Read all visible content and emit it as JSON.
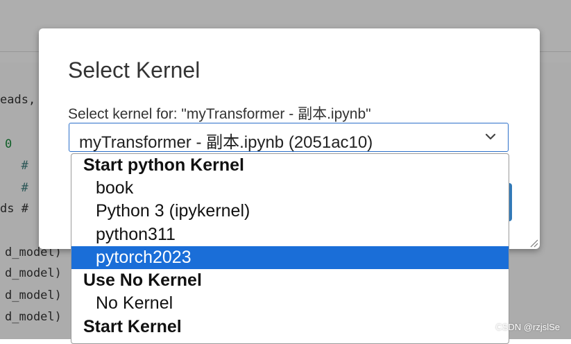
{
  "background": {
    "code_lines": [
      {
        "text": "eads,",
        "y": 0
      },
      {
        "text": "0",
        "y": 1
      },
      {
        "text": "  #",
        "y": 2
      },
      {
        "text": "  #",
        "y": 3
      },
      {
        "text": "ds #",
        "y": 4
      },
      {
        "text": "d_model)",
        "y": 5
      },
      {
        "text": "d_model)",
        "y": 6
      },
      {
        "text": "d_model)",
        "y": 7
      },
      {
        "text": "d_model)",
        "y": 8
      }
    ]
  },
  "modal": {
    "title": "Select Kernel",
    "label": "Select kernel for: \"myTransformer - 副本.ipynb\"",
    "select_value": "myTransformer - 副本.ipynb (2051ac10)"
  },
  "dropdown": {
    "options": [
      {
        "label": "Start python Kernel",
        "kind": "group",
        "selected": false
      },
      {
        "label": "book",
        "kind": "item",
        "selected": false
      },
      {
        "label": "Python 3 (ipykernel)",
        "kind": "item",
        "selected": false
      },
      {
        "label": "python311",
        "kind": "item",
        "selected": false
      },
      {
        "label": "pytorch2023",
        "kind": "item",
        "selected": true
      },
      {
        "label": "Use No Kernel",
        "kind": "group",
        "selected": false
      },
      {
        "label": "No Kernel",
        "kind": "item",
        "selected": false
      },
      {
        "label": "Start Kernel",
        "kind": "group",
        "selected": false
      }
    ]
  },
  "watermark": "CSDN @rzjslSe",
  "colors": {
    "accent": "#1a6ed8",
    "select_border": "#2b6fc9",
    "primary_button": "#337ab7"
  }
}
